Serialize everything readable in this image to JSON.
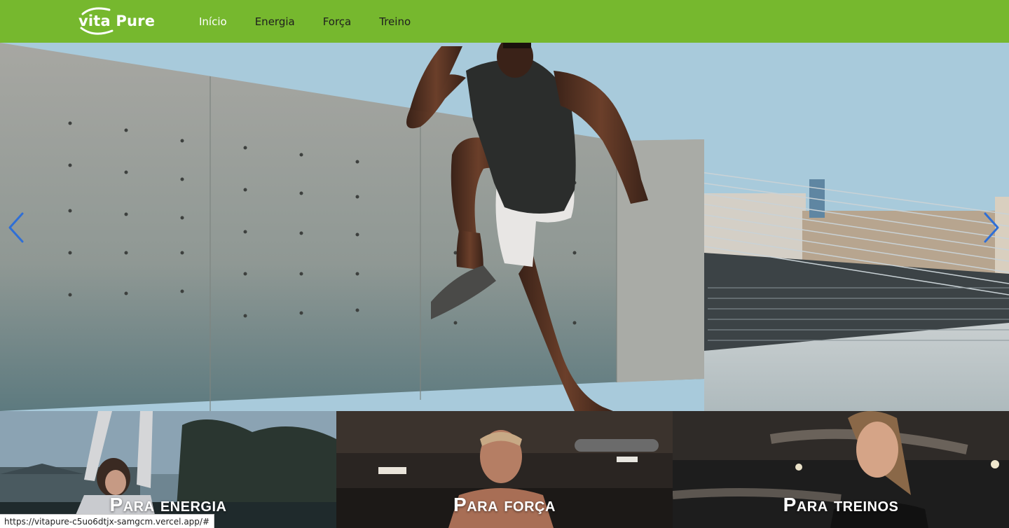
{
  "brand": {
    "name_part1": "vita",
    "name_part2": "Pure"
  },
  "nav": {
    "items": [
      {
        "label": "Início",
        "active": true
      },
      {
        "label": "Energia",
        "active": false
      },
      {
        "label": "Força",
        "active": false
      },
      {
        "label": "Treino",
        "active": false
      }
    ]
  },
  "colors": {
    "nav_bg": "#76b82e",
    "arrow": "#2f6fd6"
  },
  "hero": {
    "prev_icon": "chevron-left-icon",
    "next_icon": "chevron-right-icon"
  },
  "cards": [
    {
      "title": "Para energia"
    },
    {
      "title": "Para força"
    },
    {
      "title": "Para treinos"
    }
  ],
  "status_bar": {
    "url": "https://vitapure-c5uo6dtjx-samgcm.vercel.app/#"
  }
}
